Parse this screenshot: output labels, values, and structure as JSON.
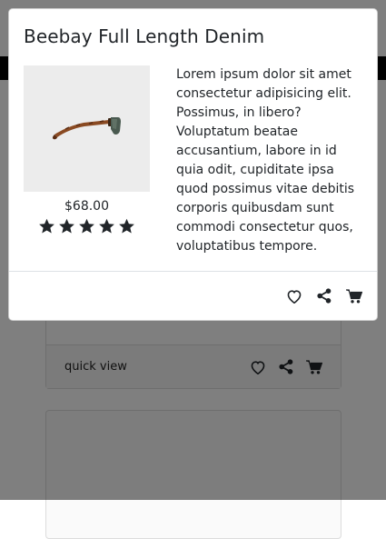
{
  "background_card": {
    "quick_view_label": "quick view"
  },
  "modal": {
    "title": "Beebay Full Length Denim",
    "product_image_subject": "sunglasses-side-view",
    "price": "$68.00",
    "rating": {
      "value": 5,
      "max": 5
    },
    "description": "Lorem ipsum dolor sit amet consectetur adipisicing elit. Possimus, in libero? Voluptatum beatae accusantium, labore in id quia odit, cupiditate ipsa quod possimus vitae debitis corporis quibusdam sunt commodi consectetur quos, voluptatibus tempore.",
    "footer_icons": [
      "heart-icon",
      "share-icon",
      "cart-icon"
    ]
  },
  "colors": {
    "text": "#212529",
    "backdrop": "rgba(0,0,0,0.5)",
    "image_background": "#ececec"
  }
}
